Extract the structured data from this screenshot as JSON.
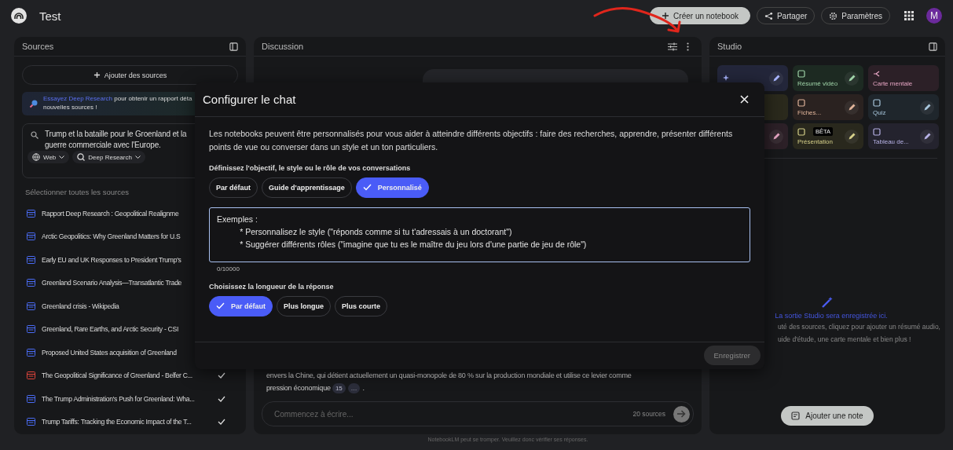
{
  "header": {
    "title": "Test",
    "buttons": [
      {
        "label": "Créer un notebook",
        "kind": "create"
      },
      {
        "label": "Partager",
        "kind": "share"
      },
      {
        "label": "Paramètres",
        "kind": "settings"
      }
    ],
    "avatar": "M"
  },
  "sources": {
    "title": "Sources",
    "add_button": "Ajouter des sources",
    "banner": {
      "link": "Essayez Deep Research",
      "lines": [
        "pour obtenir un rapport déta",
        "nouvelles sources !"
      ]
    },
    "search": {
      "lines": [
        "Trump et la bataille pour le Groenland et la",
        "guerre commerciale avec l'Europe."
      ],
      "chips": [
        {
          "label": "Web",
          "kind": "web"
        },
        {
          "label": "Deep Research",
          "kind": "research"
        }
      ]
    },
    "select_all": "Sélectionner toutes les sources",
    "items": [
      {
        "title": "Rapport Deep Research : Geopolitical Realignme",
        "kind": "report"
      },
      {
        "title": "Arctic Geopolitics: Why Greenland Matters for U.S",
        "kind": "web"
      },
      {
        "title": "Early EU and UK Responses to President Trump's",
        "kind": "web"
      },
      {
        "title": "Greenland Scenario Analysis—Transatlantic Trade",
        "kind": "web"
      },
      {
        "title": "Greenland crisis - Wikipedia",
        "kind": "web"
      },
      {
        "title": "Greenland, Rare Earths, and Arctic Security - CSI",
        "kind": "web"
      },
      {
        "title": "Proposed United States acquisition of Greenland",
        "kind": "web"
      },
      {
        "title": "The Geopolitical Significance of Greenland - Belfer C...",
        "kind": "pdf",
        "checked": true
      },
      {
        "title": "The Trump Administration's Push for Greenland: Wha...",
        "kind": "web",
        "checked": true
      },
      {
        "title": "Trump Tariffs: Tracking the Economic Impact of the T...",
        "kind": "web",
        "checked": true
      }
    ]
  },
  "discussion": {
    "title": "Discussion",
    "answer": {
      "lines": [
        "envers la Chine, qui détient actuellement un quasi-monopole de 80 % sur la production mondiale et utilise ce levier comme",
        "pression économique"
      ],
      "citations": [
        "15",
        "…"
      ],
      "end": "."
    },
    "composer": {
      "placeholder": "Commencez à écrire...",
      "count": "20 sources"
    },
    "footer": "NotebookLM peut se tromper. Veuillez donc vérifier ses réponses."
  },
  "studio": {
    "title": "Studio",
    "tiles": [
      {
        "kind": "audio",
        "color": "#23263a",
        "edit": true
      },
      {
        "label": "Résumé vidéo",
        "kind": "video",
        "color": "#1d2a22",
        "edit": true
      },
      {
        "label": "Carte mentale",
        "kind": "mindmap",
        "color": "#2c2027",
        "edit": false
      },
      {
        "kind": "report",
        "color": "#2a291c",
        "edit": false
      },
      {
        "label": "Fiches...",
        "kind": "flashcards",
        "color": "#2a2220",
        "edit": true
      },
      {
        "label": "Quiz",
        "kind": "quiz",
        "color": "#1f262c",
        "edit": true
      },
      {
        "kind": "infographic",
        "color": "#2c2027",
        "edit": true
      },
      {
        "label": "Présentation",
        "kind": "slides",
        "color": "#29281d",
        "edit": true,
        "badge": "BÊTA"
      },
      {
        "label": "Tableau de...",
        "kind": "table",
        "color": "#24232e",
        "edit": true
      }
    ],
    "empty_title": "La sortie Studio sera enregistrée ici.",
    "empty_lines": [
      "uté des sources, cliquez pour ajouter un résumé audio,",
      "uide d'étude, une carte mentale et bien plus !"
    ],
    "add_note": "Ajouter une note"
  },
  "dialog": {
    "title": "Configurer le chat",
    "description": "Les notebooks peuvent être personnalisés pour vous aider à atteindre différents objectifs : faire des recherches, apprendre, présenter différents points de vue ou converser dans un style et un ton particuliers.",
    "goal_label": "Définissez l'objectif, le style ou le rôle de vos conversations",
    "goals": [
      {
        "label": "Par défaut",
        "selected": false
      },
      {
        "label": "Guide d'apprentissage",
        "selected": false
      },
      {
        "label": "Personnalisé",
        "selected": true
      }
    ],
    "placeholder": "Exemples :\n          * Personnalisez le style (\"réponds comme si tu t'adressais à un doctorant\")\n          * Suggérer différents rôles (\"imagine que tu es le maître du jeu lors d'une partie de jeu de rôle\")",
    "counter": "0/10000",
    "length_label": "Choisissez la longueur de la réponse",
    "lengths": [
      {
        "label": "Par défaut",
        "selected": true
      },
      {
        "label": "Plus longue",
        "selected": false
      },
      {
        "label": "Plus courte",
        "selected": false
      }
    ],
    "save": {
      "label": "Enregistrer",
      "disabled": true
    }
  }
}
